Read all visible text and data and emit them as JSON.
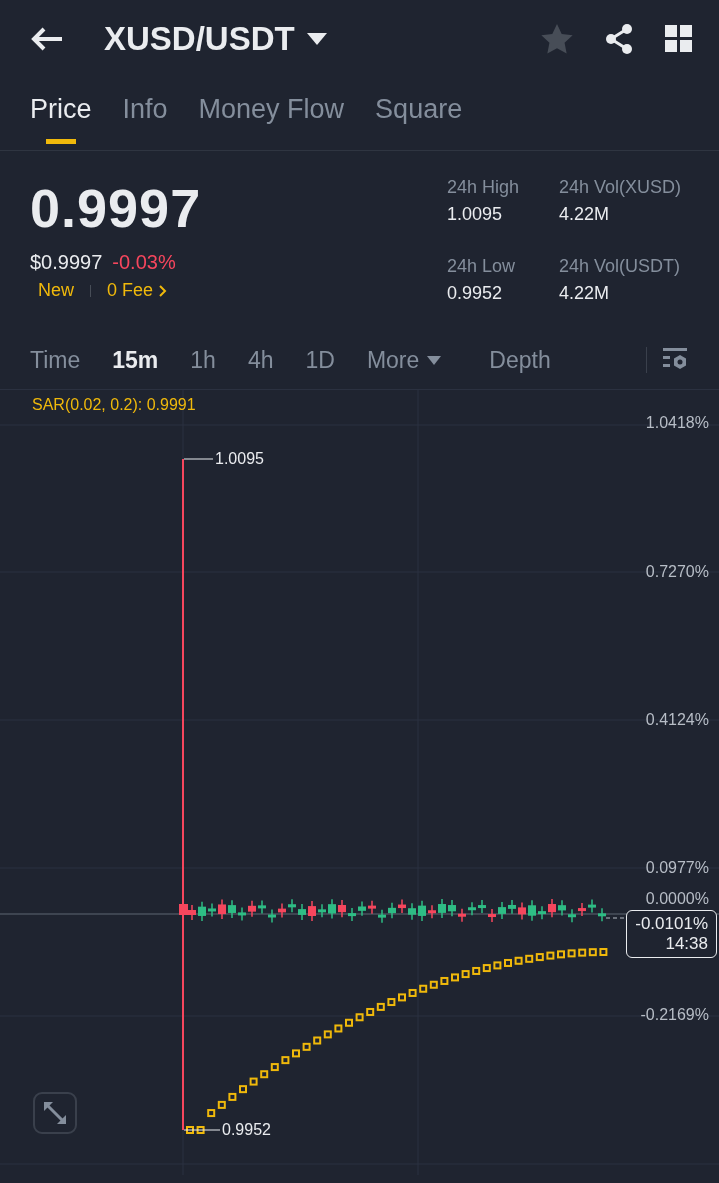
{
  "header": {
    "title": "XUSD/USDT"
  },
  "tabs": [
    {
      "label": "Price",
      "selected": true
    },
    {
      "label": "Info",
      "selected": false
    },
    {
      "label": "Money Flow",
      "selected": false
    },
    {
      "label": "Square",
      "selected": false
    }
  ],
  "ticker": {
    "price": "0.9997",
    "usd_price": "$0.9997",
    "change": "-0.03%",
    "tag": "New",
    "fee": "0 Fee"
  },
  "stats": [
    {
      "label": "24h High",
      "value": "1.0095"
    },
    {
      "label": "24h Vol(XUSD)",
      "value": "4.22M"
    },
    {
      "label": "24h Low",
      "value": "0.9952"
    },
    {
      "label": "24h Vol(USDT)",
      "value": "4.22M"
    }
  ],
  "intervals": [
    {
      "label": "Time",
      "kind": "plain",
      "selected": false
    },
    {
      "label": "15m",
      "kind": "plain",
      "selected": true
    },
    {
      "label": "1h",
      "kind": "plain",
      "selected": false
    },
    {
      "label": "4h",
      "kind": "plain",
      "selected": false
    },
    {
      "label": "1D",
      "kind": "plain",
      "selected": false
    },
    {
      "label": "More",
      "kind": "dropdown",
      "selected": false
    },
    {
      "label": "Depth",
      "kind": "plain",
      "selected": false
    }
  ],
  "chart": {
    "indicator": "SAR(0.02, 0.2): 0.9991",
    "y_labels": [
      "1.0418%",
      "0.7270%",
      "0.4124%",
      "0.0977%",
      "0.0000%",
      "-0.2169%"
    ],
    "high_label": "1.0095",
    "low_label": "0.9952",
    "last_change": "-0.0101%",
    "countdown": "14:38"
  }
}
